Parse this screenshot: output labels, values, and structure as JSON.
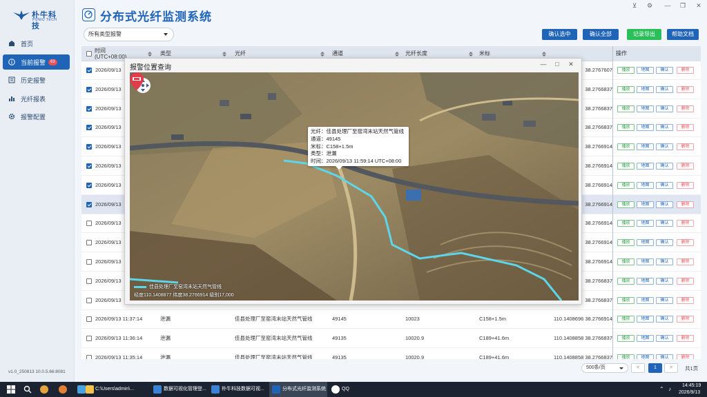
{
  "app": {
    "title": "分布式光纤监测系统",
    "logo_name": "朴牛科技",
    "logo_sub": "PUNIU TECH",
    "version": "v1.0_250813 10.0.5.66:8081"
  },
  "sidebar": {
    "items": [
      {
        "label": "首页",
        "icon": "home-icon"
      },
      {
        "label": "当前报警",
        "icon": "info-icon",
        "badge": "63"
      },
      {
        "label": "历史报警",
        "icon": "history-icon"
      },
      {
        "label": "光纤报表",
        "icon": "chart-icon"
      },
      {
        "label": "报警配置",
        "icon": "gear-icon"
      }
    ]
  },
  "filter": {
    "value": "所有类型报警"
  },
  "toolbar": {
    "confirm_selected": "确认选中",
    "confirm_all": "确认全部",
    "export": "记录导出",
    "help": "帮助文档"
  },
  "table": {
    "headers": {
      "time": "时间",
      "time_sub": "(UTC+08:00)",
      "type": "类型",
      "fiber": "光纤",
      "channel": "通道",
      "length": "光纤长度",
      "meter": "米标",
      "ops": "操作"
    },
    "op_labels": {
      "play": "播放",
      "map": "地图",
      "ack": "确认",
      "del": "删除"
    },
    "rows": [
      {
        "time": "2026/09/13",
        "lon_lat": "38.2767607",
        "checked": true
      },
      {
        "time": "2026/09/13",
        "lon_lat": "38.2766837",
        "checked": true
      },
      {
        "time": "2026/09/13",
        "lon_lat": "38.2766837",
        "checked": true
      },
      {
        "time": "2026/09/13",
        "lon_lat": "38.2766837",
        "checked": true
      },
      {
        "time": "2026/09/13",
        "lon_lat": "38.2766914",
        "checked": true
      },
      {
        "time": "2026/09/13",
        "lon_lat": "38.2766914",
        "checked": true
      },
      {
        "time": "2026/09/13",
        "lon_lat": "38.2766914",
        "checked": true
      },
      {
        "time": "2026/09/13",
        "lon_lat": "38.2766914",
        "checked": true,
        "selected": true
      },
      {
        "time": "2026/09/13",
        "lon_lat": "38.2766914",
        "checked": false
      },
      {
        "time": "2026/09/13",
        "lon_lat": "38.2766914",
        "checked": false
      },
      {
        "time": "2026/09/13",
        "lon_lat": "38.2766914",
        "checked": false
      },
      {
        "time": "2026/09/13",
        "lon_lat": "38.2766837",
        "checked": false
      },
      {
        "time": "2026/09/13",
        "lon_lat": "38.2766837",
        "checked": false
      },
      {
        "time": "2026/09/13 11:37:14",
        "type": "泄漏",
        "fiber": "佳县处理厂至窑湾末站天然气管线",
        "channel": "49145",
        "length": "10023",
        "meter": "C158+1.5m",
        "lon_lat": "110.1408696 38.2766914",
        "checked": false
      },
      {
        "time": "2026/09/13 11:36:14",
        "type": "泄漏",
        "fiber": "佳县处理厂至窑湾末站天然气管线",
        "channel": "49135",
        "length": "10020.9",
        "meter": "C189+41.6m",
        "lon_lat": "110.1408858 38.2766837",
        "checked": false
      },
      {
        "time": "2026/09/13 11:35:14",
        "type": "泄漏",
        "fiber": "佳县处理厂至窑湾末站天然气管线",
        "channel": "49135",
        "length": "10020.9",
        "meter": "C189+41.6m",
        "lon_lat": "110.1408858 38.2766837",
        "checked": false
      }
    ]
  },
  "pager": {
    "size": "500条/页",
    "prev": "<",
    "current": "1",
    "next": ">",
    "total": "共1页"
  },
  "modal": {
    "title": "报警位置查询",
    "popup": {
      "fiber": "光纤：佳县处理厂至窑湾末站天然气管线",
      "channel": "通道：49145",
      "meter": "米标：C158+1.5m",
      "type": "类型：泄漏",
      "time": "时间：2026/09/13 11:59:14 UTC+08:00"
    },
    "legend": "佳县处理厂至窑湾末站天然气管线",
    "coords": "经度110.1408877  纬度38.2766914  级别17,000"
  },
  "taskbar": {
    "items": [
      {
        "label": "C:\\Users\\admin\\..."
      },
      {
        "label": "数据可视化管理登..."
      },
      {
        "label": "朴牛科技数据可视..."
      },
      {
        "label": "分布式光纤监测系统"
      },
      {
        "label": "QQ"
      }
    ],
    "time": "14:45:19",
    "date": "2026/9/13"
  },
  "colors": {
    "primary": "#1f64b7",
    "success": "#2e9f48",
    "danger": "#e3545c",
    "export": "#2bbf5a",
    "pipeline": "#5cd6e8"
  }
}
